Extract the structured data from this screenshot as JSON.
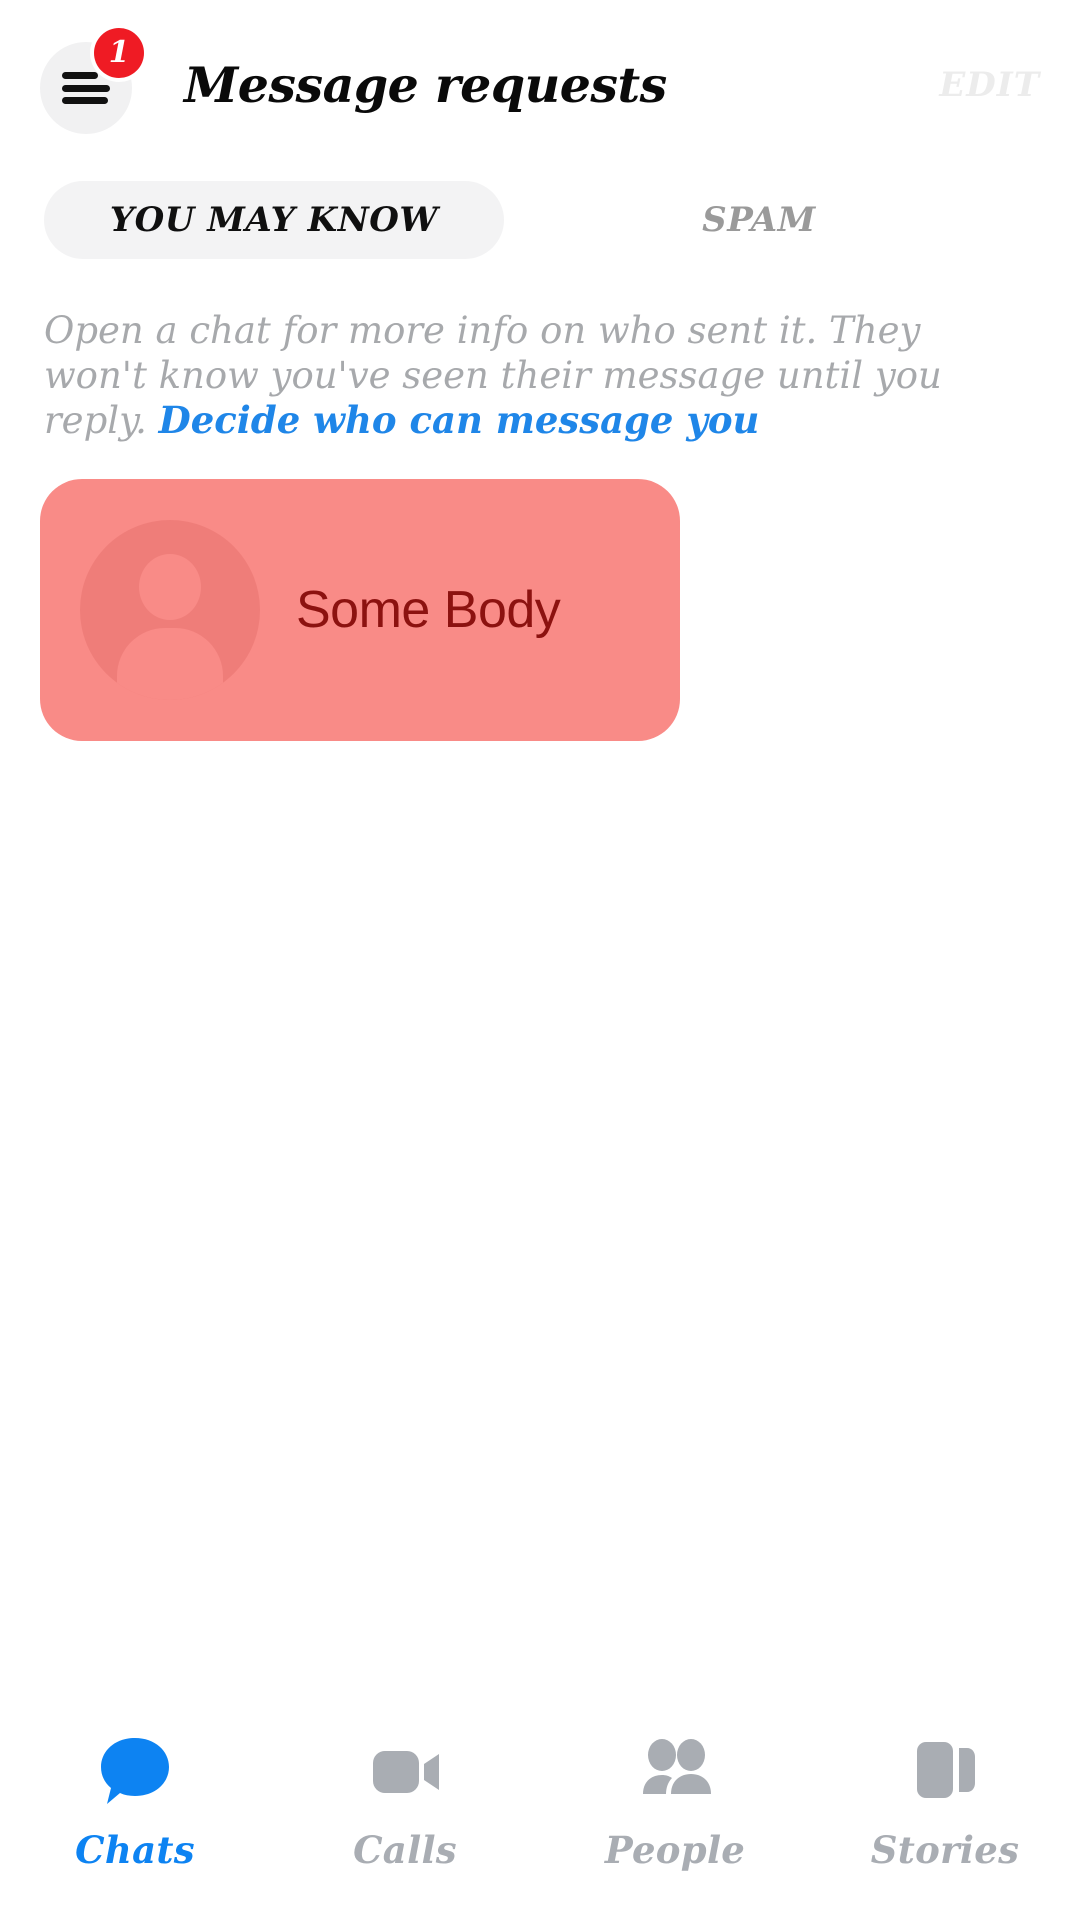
{
  "header": {
    "title": "Message requests",
    "edit_label": "EDIT",
    "menu_icon": "hamburger-menu-icon",
    "badge_count": "1",
    "badge_color": "#ef1b24",
    "menu_circle_color": "#f1f1f2",
    "edit_color": "#ececec"
  },
  "tabs": [
    {
      "label": "YOU MAY KNOW",
      "active": true,
      "bg": "#f3f3f4",
      "color": "#101010"
    },
    {
      "label": "SPAM",
      "active": false,
      "bg": "transparent",
      "color": "#9a9a9a"
    }
  ],
  "description": {
    "text": "Open a chat for more info on who sent it. They won't know you've seen their message until you reply. ",
    "link_text": "Decide who can message you",
    "text_color": "#a7a9ac",
    "link_color": "#1f86e8"
  },
  "requests": [
    {
      "name": "Some Body",
      "avatar_icon": "person-placeholder-icon",
      "card_color": "#f98b87",
      "avatar_color": "#ef7d79",
      "name_color": "#8c1210"
    }
  ],
  "bottom_nav": {
    "active_color": "#0d83f2",
    "inactive_color": "#a9adb3",
    "items": [
      {
        "label": "Chats",
        "icon": "chat-bubble-icon",
        "active": true
      },
      {
        "label": "Calls",
        "icon": "video-camera-icon",
        "active": false
      },
      {
        "label": "People",
        "icon": "people-icon",
        "active": false
      },
      {
        "label": "Stories",
        "icon": "stories-cards-icon",
        "active": false
      }
    ]
  }
}
